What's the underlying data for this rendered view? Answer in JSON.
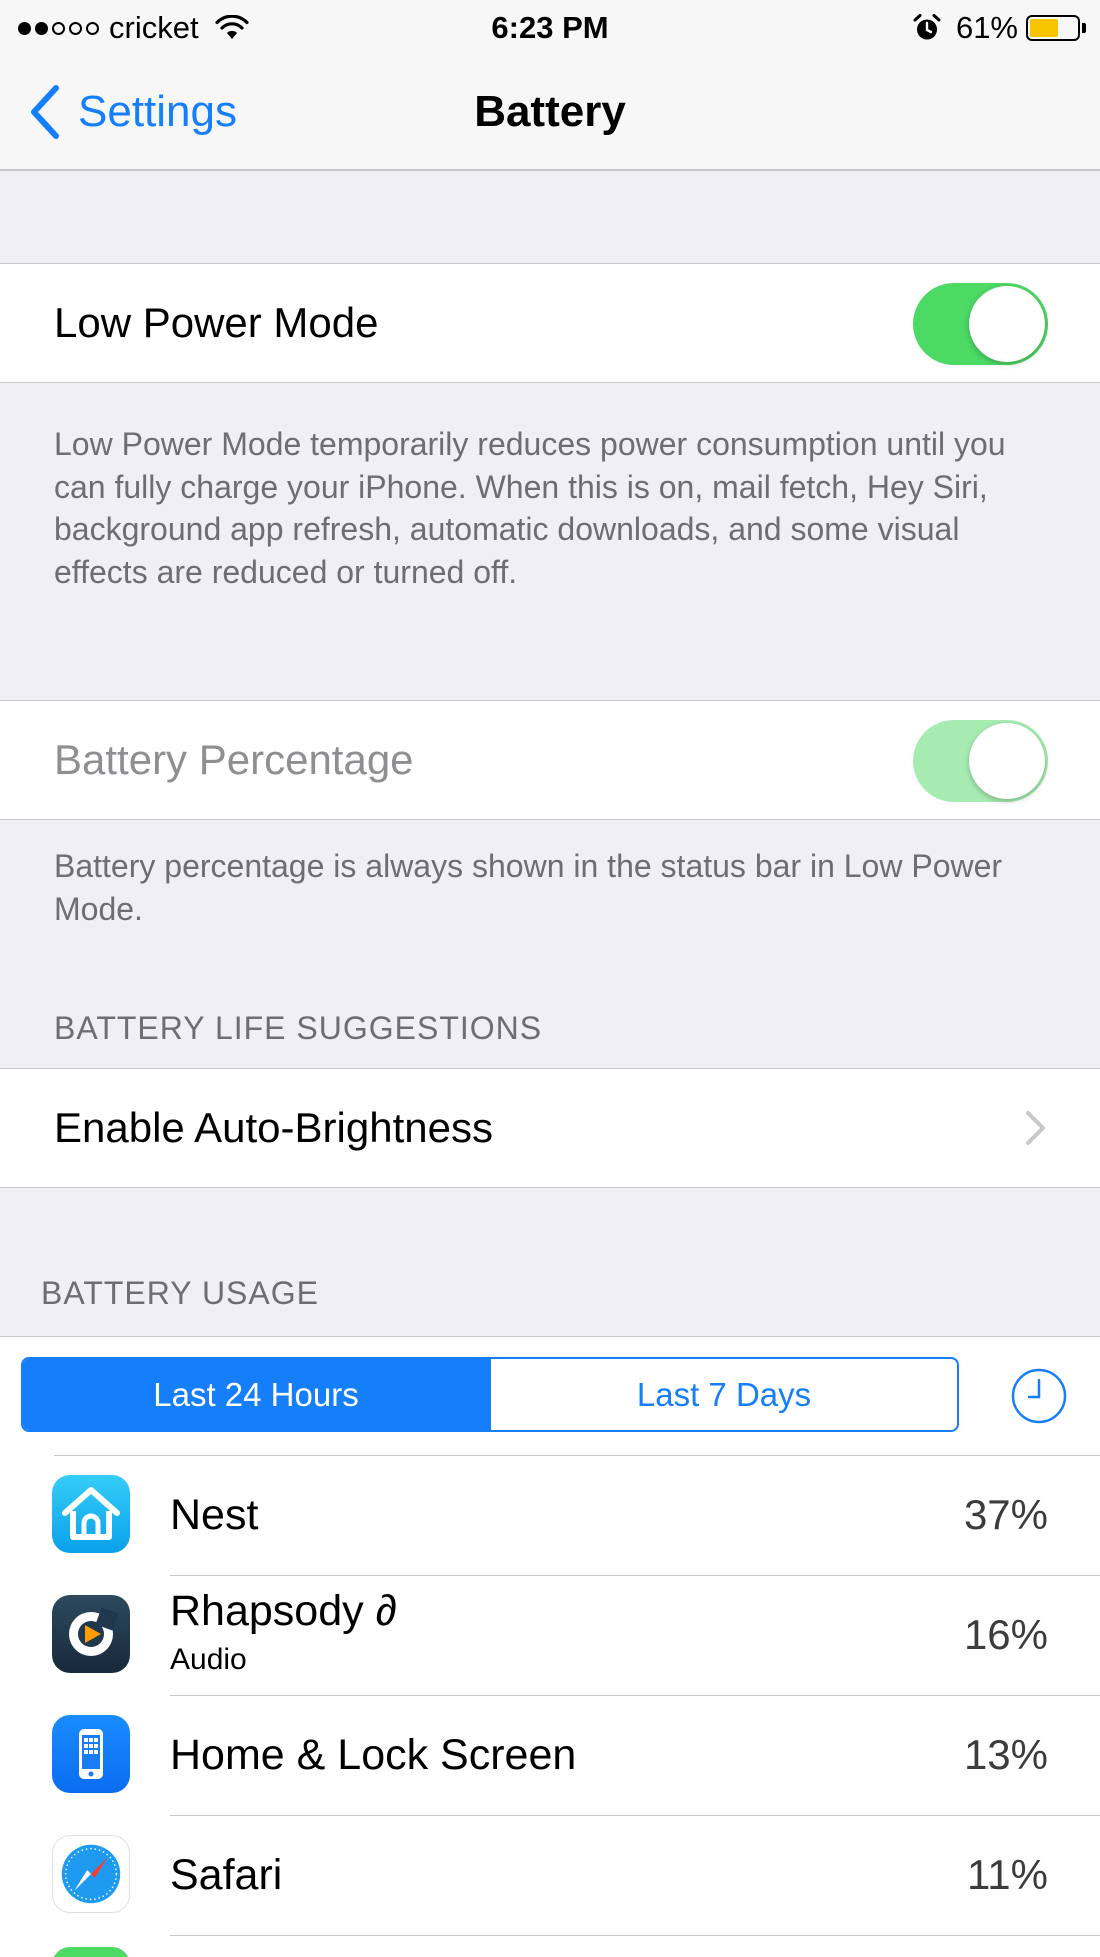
{
  "status_bar": {
    "carrier": "cricket",
    "time": "6:23 PM",
    "battery_text": "61%",
    "battery_level": 0.61,
    "battery_color": "#f7c500",
    "signal_bars_filled": 2,
    "signal_bars_total": 5,
    "icons": [
      "signal-dots-icon",
      "wifi-icon",
      "alarm-icon",
      "battery-icon"
    ]
  },
  "nav": {
    "back_label": "Settings",
    "title": "Battery"
  },
  "low_power": {
    "label": "Low Power Mode",
    "on": true,
    "footer": "Low Power Mode temporarily reduces power consumption until you can fully charge your iPhone. When this is on, mail fetch, Hey Siri, background app refresh, automatic downloads, and some visual effects are reduced or turned off."
  },
  "battery_percentage": {
    "label": "Battery Percentage",
    "on": true,
    "disabled": true,
    "footer": "Battery percentage is always shown in the status bar in Low Power Mode."
  },
  "suggestions": {
    "header": "BATTERY LIFE SUGGESTIONS",
    "items": [
      {
        "label": "Enable Auto-Brightness"
      }
    ]
  },
  "usage": {
    "header": "BATTERY USAGE",
    "tabs": [
      {
        "label": "Last 24 Hours",
        "active": true
      },
      {
        "label": "Last 7 Days",
        "active": false
      }
    ],
    "apps": [
      {
        "name": "Nest",
        "sub": "",
        "percent": "37%",
        "icon": "nest-home-icon"
      },
      {
        "name": "Rhapsody ∂",
        "sub": "Audio",
        "percent": "16%",
        "icon": "rhapsody-icon"
      },
      {
        "name": "Home & Lock Screen",
        "sub": "",
        "percent": "13%",
        "icon": "iphone-icon"
      },
      {
        "name": "Safari",
        "sub": "",
        "percent": "11%",
        "icon": "safari-compass-icon"
      }
    ]
  },
  "colors": {
    "accent": "#157efb",
    "toggle_on": "#4cd964",
    "toggle_disabled": "#a6ecb1",
    "background": "#efeff4"
  }
}
